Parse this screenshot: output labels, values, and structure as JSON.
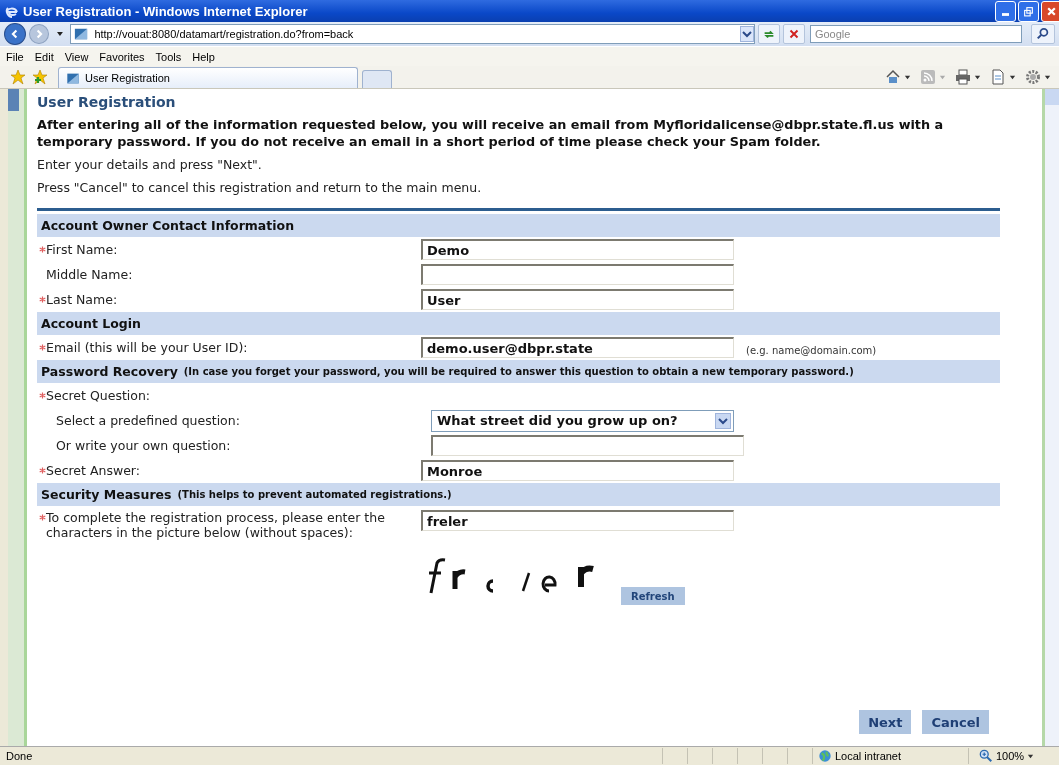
{
  "window": {
    "title": "User Registration - Windows Internet Explorer"
  },
  "address_bar": {
    "url": "http://vouat:8080/datamart/registration.do?from=back",
    "search_placeholder": "Google"
  },
  "menu": [
    "File",
    "Edit",
    "View",
    "Favorites",
    "Tools",
    "Help"
  ],
  "tabs": [
    {
      "label": "User Registration",
      "selected": true
    }
  ],
  "page": {
    "heading": "User Registration",
    "intro": "After entering all of the information requested below, you will receive an email from Myfloridalicense@dbpr.state.fl.us with a temporary password. If you do not receive an email in a short period of time please check your Spam folder.",
    "instructions": [
      "Enter your details and press \"Next\".",
      "Press \"Cancel\" to cancel this registration and return to the main menu."
    ],
    "sections": [
      {
        "title": "Account Owner Contact Information",
        "rows": [
          {
            "label": "First Name:",
            "required": true,
            "kind": "text",
            "value": "Demo"
          },
          {
            "label": "Middle Name:",
            "required": false,
            "kind": "text"
          },
          {
            "label": "Last Name:",
            "required": true,
            "kind": "text",
            "value": "User"
          }
        ]
      },
      {
        "title": "Account Login",
        "rows": [
          {
            "label": "Email (this will be your User ID):",
            "required": true,
            "kind": "text",
            "value": "demo.user@dbpr.state",
            "hint": "(e.g. name@domain.com)"
          }
        ]
      },
      {
        "title": "Password Recovery",
        "note": "(In case you forget your password, you will be required to answer this question to obtain a new temporary password.)",
        "rows": [
          {
            "label": "Secret Question:",
            "required": true,
            "kind": "group",
            "children": [
              {
                "label": "Select a predefined question:",
                "required": false,
                "kind": "select",
                "value": "What street did you grow up on?"
              },
              {
                "label": "Or write your own question:",
                "required": false,
                "kind": "text"
              }
            ]
          },
          {
            "label": "Secret Answer:",
            "required": true,
            "kind": "text",
            "value": "Monroe"
          }
        ]
      },
      {
        "title": "Security Measures",
        "note": "(This helps to prevent automated registrations.)",
        "rows": [
          {
            "label": "To complete the registration process, please enter the characters in the picture below (without spaces):",
            "required": true,
            "kind": "text",
            "value": "freler"
          }
        ]
      }
    ],
    "refresh_button": "Refresh",
    "buttons": [
      "Next",
      "Cancel"
    ]
  },
  "status_bar": {
    "status": "Done",
    "zone": "Local intranet",
    "zoom": "100%"
  }
}
